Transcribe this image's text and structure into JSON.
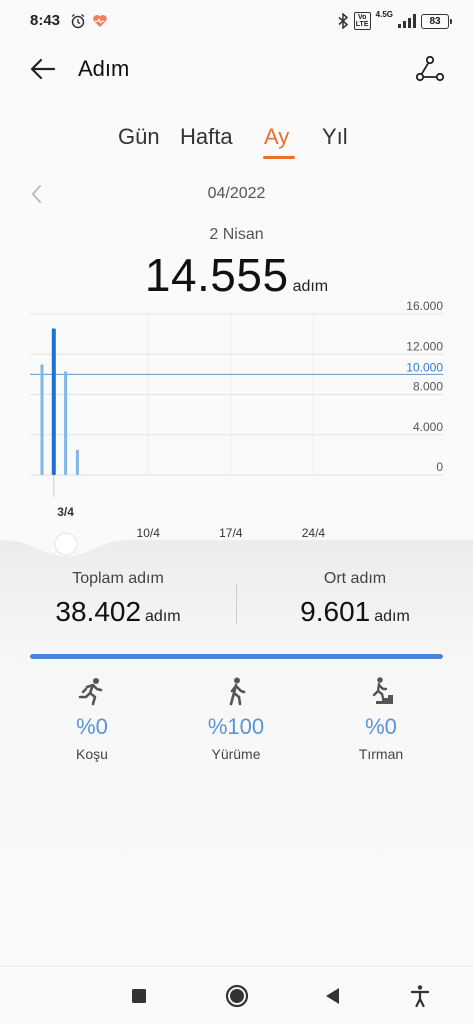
{
  "status_bar": {
    "time": "8:43",
    "network": "4.5G",
    "volte": "Vo LTE",
    "battery": "83",
    "icons": [
      "alarm-icon",
      "health-heart-icon",
      "bluetooth-icon",
      "volte-icon",
      "signal-icon",
      "battery-icon"
    ]
  },
  "header": {
    "title": "Adım",
    "back_icon": "back-arrow-icon",
    "share_icon": "share-icon"
  },
  "tabs": [
    {
      "label": "Gün",
      "active": false
    },
    {
      "label": "Hafta",
      "active": false
    },
    {
      "label": "Ay",
      "active": true
    },
    {
      "label": "Yıl",
      "active": false
    }
  ],
  "period": {
    "label": "04/2022",
    "prev_icon": "chevron-left-icon"
  },
  "selected": {
    "date": "2 Nisan",
    "value": "14.555",
    "unit": "adım"
  },
  "chart_data": {
    "type": "bar",
    "x": [
      1,
      2,
      3,
      4,
      5,
      6,
      7,
      8,
      9,
      10,
      11,
      12,
      13,
      14,
      15,
      16,
      17,
      18,
      19,
      20,
      21,
      22,
      23,
      24,
      25,
      26,
      27,
      28,
      29,
      30
    ],
    "values": [
      11000,
      14555,
      10300,
      2500,
      null,
      null,
      null,
      null,
      null,
      null,
      null,
      null,
      null,
      null,
      null,
      null,
      null,
      null,
      null,
      null,
      null,
      null,
      null,
      null,
      null,
      null,
      null,
      null,
      null,
      null
    ],
    "selected_index": 1,
    "ylim": [
      0,
      16000
    ],
    "y_ticks": [
      "0",
      "4.000",
      "8.000",
      "12.000",
      "16.000"
    ],
    "y_tick_values": [
      0,
      4000,
      8000,
      12000,
      16000
    ],
    "average_line": {
      "value": 10000,
      "label": "10.000"
    },
    "x_labels": [
      {
        "day": 3,
        "label": "3/4"
      },
      {
        "day": 10,
        "label": "10/4"
      },
      {
        "day": 17,
        "label": "17/4"
      },
      {
        "day": 24,
        "label": "24/4"
      }
    ],
    "grid": true,
    "colors": {
      "bar": "#7fb6ea",
      "bar_selected": "#1f6fd6",
      "average_line": "#5b95c9",
      "grid": "#e2e2e2"
    }
  },
  "stats": {
    "total": {
      "label": "Toplam adım",
      "value": "38.402",
      "unit": "adım"
    },
    "average": {
      "label": "Ort adım",
      "value": "9.601",
      "unit": "adım"
    }
  },
  "activity_split": {
    "walking_fraction": 1.0,
    "items": [
      {
        "label": "Koşu",
        "percent": "%0",
        "icon": "running-icon"
      },
      {
        "label": "Yürüme",
        "percent": "%100",
        "icon": "walking-icon"
      },
      {
        "label": "Tırman",
        "percent": "%0",
        "icon": "climbing-icon"
      }
    ]
  },
  "nav": {
    "icons": [
      "recent-apps-icon",
      "home-icon",
      "back-icon",
      "accessibility-icon"
    ]
  }
}
